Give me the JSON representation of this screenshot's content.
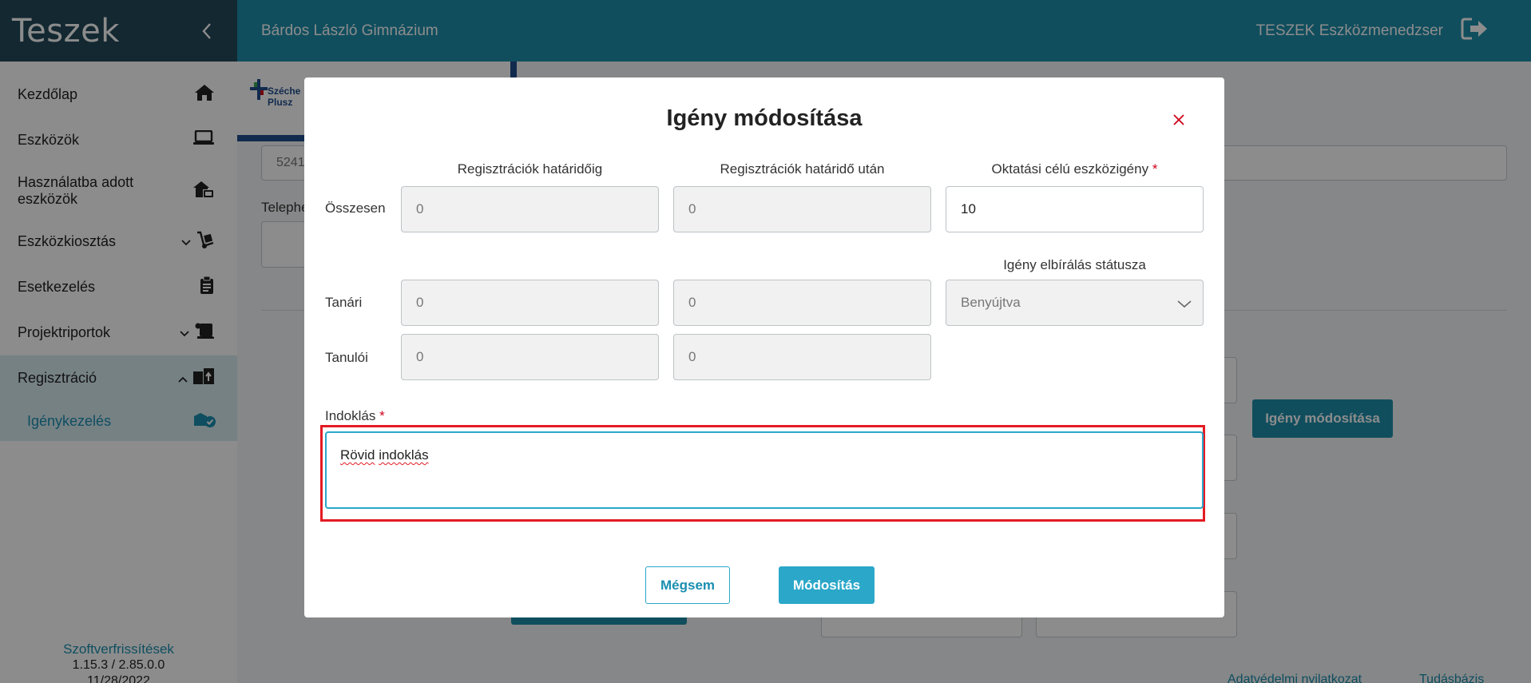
{
  "sidebar": {
    "brand": "Teszek",
    "items": [
      {
        "label": "Kezdőlap",
        "icon": "home-icon"
      },
      {
        "label": "Eszközök",
        "icon": "laptop-icon"
      },
      {
        "label": "Használatba adott eszközök",
        "icon": "house-device-icon"
      },
      {
        "label": "Eszközkiosztás",
        "icon": "dolly-icon"
      },
      {
        "label": "Esetkezelés",
        "icon": "clipboard-icon"
      },
      {
        "label": "Projektriportok",
        "icon": "scroll-icon"
      },
      {
        "label": "Regisztráció",
        "icon": "boxes-icon"
      }
    ],
    "sub_item": {
      "label": "Igénykezelés",
      "icon": "box-check-icon"
    },
    "footer": {
      "link": "Szoftverfrissítések",
      "version": "1.15.3 / 2.85.0.0",
      "date": "11/28/2022"
    }
  },
  "topbar": {
    "school": "Bárdos László Gimnázium",
    "app_name": "TESZEK Eszközmenedzser"
  },
  "background": {
    "logo_text_1": "Széche",
    "logo_text_2": "Plusz",
    "field_value": "5241",
    "label_telephely": "Telephe",
    "button": "Igény módosítása",
    "footer_link_1": "Adatvédelmi nyilatkozat",
    "footer_link_2": "Tudásbázis"
  },
  "modal": {
    "title": "Igény módosítása",
    "columns": {
      "before_deadline": "Regisztrációk határidőig",
      "after_deadline": "Regisztrációk határidő után",
      "edu_demand": "Oktatási célú eszközigény",
      "status_label": "Igény elbírálás státusza"
    },
    "rows": {
      "total_label": "Összesen",
      "teacher_label": "Tanári",
      "student_label": "Tanulói"
    },
    "values": {
      "total_before": "0",
      "total_after": "0",
      "total_edu": "10",
      "teacher_before": "0",
      "teacher_after": "0",
      "student_before": "0",
      "student_after": "0",
      "status": "Benyújtva"
    },
    "reason_label": "Indoklás",
    "reason_value_word1": "Rövid",
    "reason_value_word2": "indoklás",
    "required_mark": "*",
    "cancel_label": "Mégsem",
    "submit_label": "Módosítás"
  },
  "colors": {
    "sidebar_header": "#24495a",
    "topbar": "#1e8fab",
    "accent": "#2aa7c9",
    "highlight": "#e31b23"
  }
}
